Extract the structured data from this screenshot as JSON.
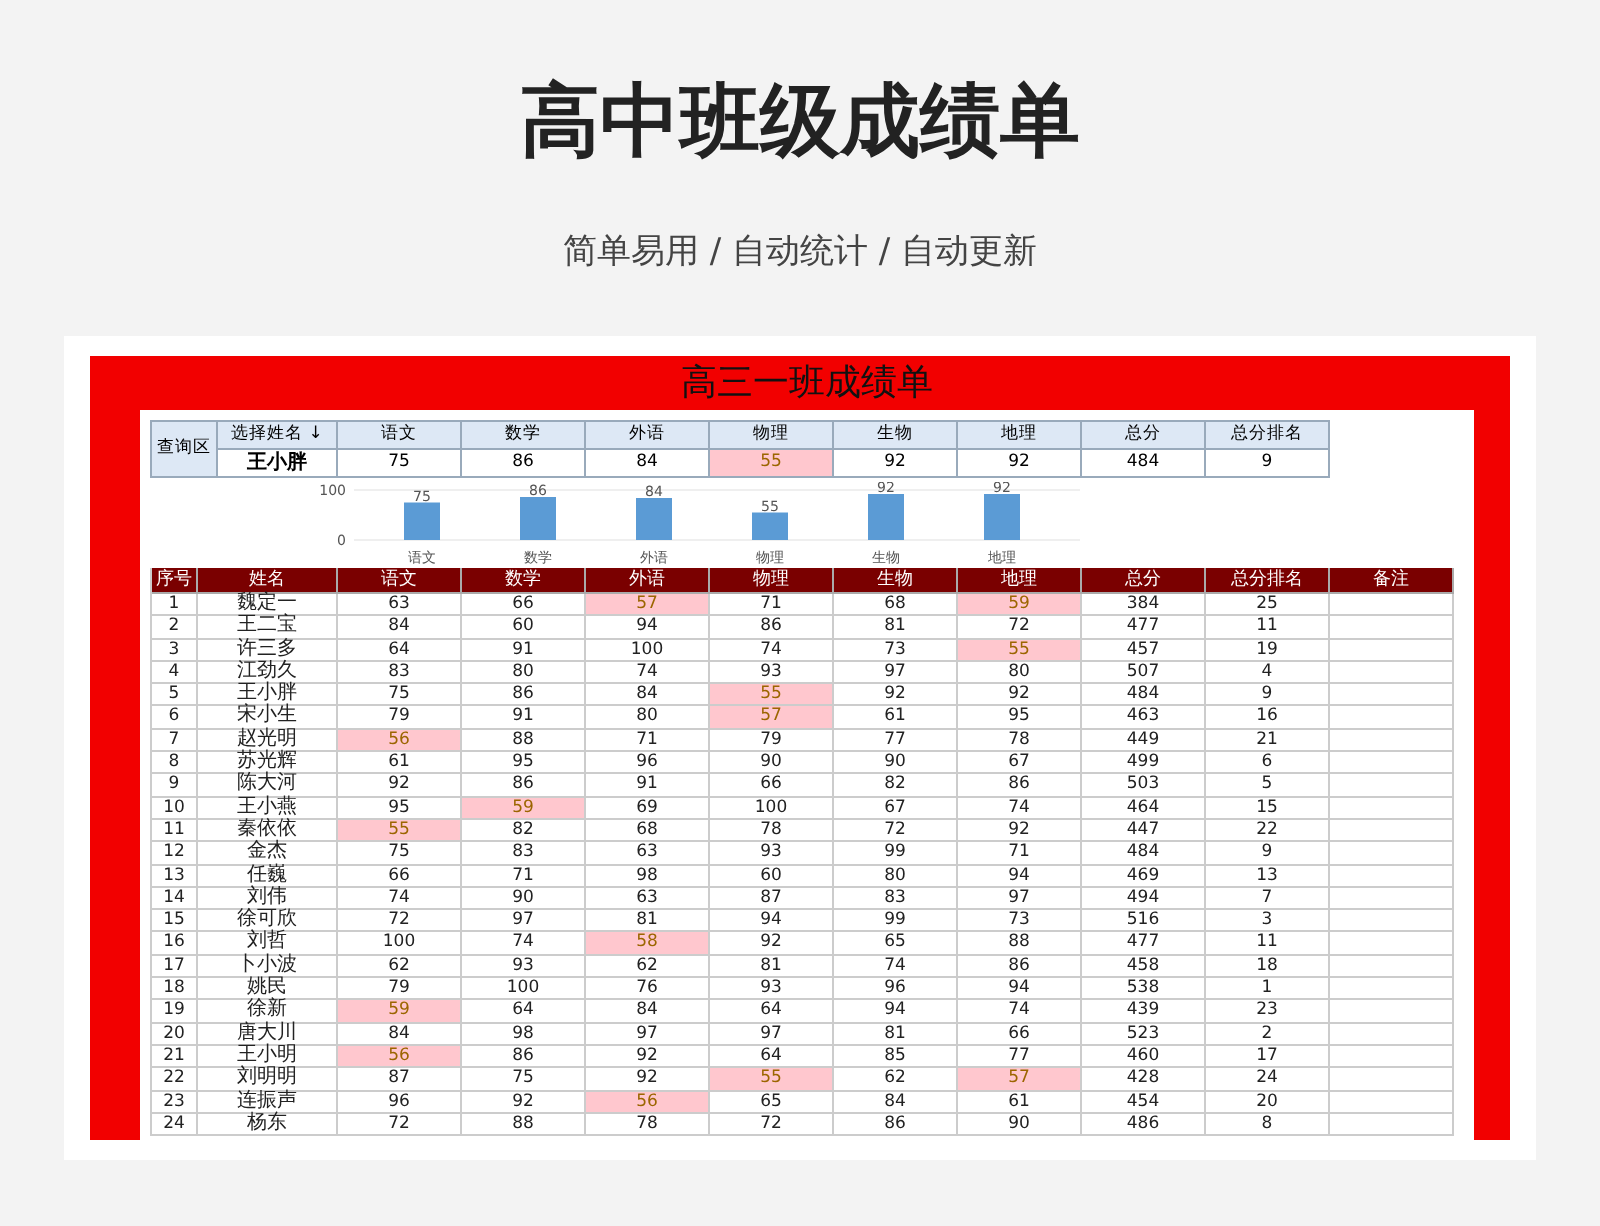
{
  "header": {
    "title": "高中班级成绩单",
    "subtitle": "简单易用 / 自动统计 / 自动更新"
  },
  "sheet": {
    "title": "高三一班成绩单",
    "query": {
      "label": "查询区",
      "select_label": "选择姓名 ↓",
      "columns": [
        "语文",
        "数学",
        "外语",
        "物理",
        "生物",
        "地理",
        "总分",
        "总分排名"
      ],
      "name": "王小胖",
      "values": [
        {
          "value": "75",
          "low": false
        },
        {
          "value": "86",
          "low": false
        },
        {
          "value": "84",
          "low": false
        },
        {
          "value": "55",
          "low": true
        },
        {
          "value": "92",
          "low": false
        },
        {
          "value": "92",
          "low": false
        },
        {
          "value": "484",
          "low": false
        },
        {
          "value": "9",
          "low": false
        }
      ]
    },
    "chart_data": {
      "type": "bar",
      "categories": [
        "语文",
        "数学",
        "外语",
        "物理",
        "生物",
        "地理"
      ],
      "values": [
        75,
        86,
        84,
        55,
        92,
        92
      ],
      "ylim": [
        0,
        100
      ],
      "yticks": [
        0,
        100
      ],
      "value_labels": [
        "75",
        "86",
        "84",
        "55",
        "92",
        "92"
      ]
    },
    "table": {
      "columns": [
        "序号",
        "姓名",
        "语文",
        "数学",
        "外语",
        "物理",
        "生物",
        "地理",
        "总分",
        "总分排名",
        "备注"
      ],
      "rows": [
        {
          "no": "1",
          "name": "魏定一",
          "scores": [
            {
              "value": "63",
              "low": false
            },
            {
              "value": "66",
              "low": false
            },
            {
              "value": "57",
              "low": true
            },
            {
              "value": "71",
              "low": false
            },
            {
              "value": "68",
              "low": false
            },
            {
              "value": "59",
              "low": true
            }
          ],
          "total": "384",
          "rank": "25"
        },
        {
          "no": "2",
          "name": "王二宝",
          "scores": [
            {
              "value": "84",
              "low": false
            },
            {
              "value": "60",
              "low": false
            },
            {
              "value": "94",
              "low": false
            },
            {
              "value": "86",
              "low": false
            },
            {
              "value": "81",
              "low": false
            },
            {
              "value": "72",
              "low": false
            }
          ],
          "total": "477",
          "rank": "11"
        },
        {
          "no": "3",
          "name": "许三多",
          "scores": [
            {
              "value": "64",
              "low": false
            },
            {
              "value": "91",
              "low": false
            },
            {
              "value": "100",
              "low": false
            },
            {
              "value": "74",
              "low": false
            },
            {
              "value": "73",
              "low": false
            },
            {
              "value": "55",
              "low": true
            }
          ],
          "total": "457",
          "rank": "19"
        },
        {
          "no": "4",
          "name": "江劲久",
          "scores": [
            {
              "value": "83",
              "low": false
            },
            {
              "value": "80",
              "low": false
            },
            {
              "value": "74",
              "low": false
            },
            {
              "value": "93",
              "low": false
            },
            {
              "value": "97",
              "low": false
            },
            {
              "value": "80",
              "low": false
            }
          ],
          "total": "507",
          "rank": "4"
        },
        {
          "no": "5",
          "name": "王小胖",
          "scores": [
            {
              "value": "75",
              "low": false
            },
            {
              "value": "86",
              "low": false
            },
            {
              "value": "84",
              "low": false
            },
            {
              "value": "55",
              "low": true
            },
            {
              "value": "92",
              "low": false
            },
            {
              "value": "92",
              "low": false
            }
          ],
          "total": "484",
          "rank": "9"
        },
        {
          "no": "6",
          "name": "宋小生",
          "scores": [
            {
              "value": "79",
              "low": false
            },
            {
              "value": "91",
              "low": false
            },
            {
              "value": "80",
              "low": false
            },
            {
              "value": "57",
              "low": true
            },
            {
              "value": "61",
              "low": false
            },
            {
              "value": "95",
              "low": false
            }
          ],
          "total": "463",
          "rank": "16"
        },
        {
          "no": "7",
          "name": "赵光明",
          "scores": [
            {
              "value": "56",
              "low": true
            },
            {
              "value": "88",
              "low": false
            },
            {
              "value": "71",
              "low": false
            },
            {
              "value": "79",
              "low": false
            },
            {
              "value": "77",
              "low": false
            },
            {
              "value": "78",
              "low": false
            }
          ],
          "total": "449",
          "rank": "21"
        },
        {
          "no": "8",
          "name": "苏光辉",
          "scores": [
            {
              "value": "61",
              "low": false
            },
            {
              "value": "95",
              "low": false
            },
            {
              "value": "96",
              "low": false
            },
            {
              "value": "90",
              "low": false
            },
            {
              "value": "90",
              "low": false
            },
            {
              "value": "67",
              "low": false
            }
          ],
          "total": "499",
          "rank": "6"
        },
        {
          "no": "9",
          "name": "陈大河",
          "scores": [
            {
              "value": "92",
              "low": false
            },
            {
              "value": "86",
              "low": false
            },
            {
              "value": "91",
              "low": false
            },
            {
              "value": "66",
              "low": false
            },
            {
              "value": "82",
              "low": false
            },
            {
              "value": "86",
              "low": false
            }
          ],
          "total": "503",
          "rank": "5"
        },
        {
          "no": "10",
          "name": "王小燕",
          "scores": [
            {
              "value": "95",
              "low": false
            },
            {
              "value": "59",
              "low": true
            },
            {
              "value": "69",
              "low": false
            },
            {
              "value": "100",
              "low": false
            },
            {
              "value": "67",
              "low": false
            },
            {
              "value": "74",
              "low": false
            }
          ],
          "total": "464",
          "rank": "15"
        },
        {
          "no": "11",
          "name": "秦依依",
          "scores": [
            {
              "value": "55",
              "low": true
            },
            {
              "value": "82",
              "low": false
            },
            {
              "value": "68",
              "low": false
            },
            {
              "value": "78",
              "low": false
            },
            {
              "value": "72",
              "low": false
            },
            {
              "value": "92",
              "low": false
            }
          ],
          "total": "447",
          "rank": "22"
        },
        {
          "no": "12",
          "name": "金杰",
          "scores": [
            {
              "value": "75",
              "low": false
            },
            {
              "value": "83",
              "low": false
            },
            {
              "value": "63",
              "low": false
            },
            {
              "value": "93",
              "low": false
            },
            {
              "value": "99",
              "low": false
            },
            {
              "value": "71",
              "low": false
            }
          ],
          "total": "484",
          "rank": "9"
        },
        {
          "no": "13",
          "name": "任巍",
          "scores": [
            {
              "value": "66",
              "low": false
            },
            {
              "value": "71",
              "low": false
            },
            {
              "value": "98",
              "low": false
            },
            {
              "value": "60",
              "low": false
            },
            {
              "value": "80",
              "low": false
            },
            {
              "value": "94",
              "low": false
            }
          ],
          "total": "469",
          "rank": "13"
        },
        {
          "no": "14",
          "name": "刘伟",
          "scores": [
            {
              "value": "74",
              "low": false
            },
            {
              "value": "90",
              "low": false
            },
            {
              "value": "63",
              "low": false
            },
            {
              "value": "87",
              "low": false
            },
            {
              "value": "83",
              "low": false
            },
            {
              "value": "97",
              "low": false
            }
          ],
          "total": "494",
          "rank": "7"
        },
        {
          "no": "15",
          "name": "徐可欣",
          "scores": [
            {
              "value": "72",
              "low": false
            },
            {
              "value": "97",
              "low": false
            },
            {
              "value": "81",
              "low": false
            },
            {
              "value": "94",
              "low": false
            },
            {
              "value": "99",
              "low": false
            },
            {
              "value": "73",
              "low": false
            }
          ],
          "total": "516",
          "rank": "3"
        },
        {
          "no": "16",
          "name": "刘哲",
          "scores": [
            {
              "value": "100",
              "low": false
            },
            {
              "value": "74",
              "low": false
            },
            {
              "value": "58",
              "low": true
            },
            {
              "value": "92",
              "low": false
            },
            {
              "value": "65",
              "low": false
            },
            {
              "value": "88",
              "low": false
            }
          ],
          "total": "477",
          "rank": "11"
        },
        {
          "no": "17",
          "name": "卜小波",
          "scores": [
            {
              "value": "62",
              "low": false
            },
            {
              "value": "93",
              "low": false
            },
            {
              "value": "62",
              "low": false
            },
            {
              "value": "81",
              "low": false
            },
            {
              "value": "74",
              "low": false
            },
            {
              "value": "86",
              "low": false
            }
          ],
          "total": "458",
          "rank": "18"
        },
        {
          "no": "18",
          "name": "姚民",
          "scores": [
            {
              "value": "79",
              "low": false
            },
            {
              "value": "100",
              "low": false
            },
            {
              "value": "76",
              "low": false
            },
            {
              "value": "93",
              "low": false
            },
            {
              "value": "96",
              "low": false
            },
            {
              "value": "94",
              "low": false
            }
          ],
          "total": "538",
          "rank": "1"
        },
        {
          "no": "19",
          "name": "徐新",
          "scores": [
            {
              "value": "59",
              "low": true
            },
            {
              "value": "64",
              "low": false
            },
            {
              "value": "84",
              "low": false
            },
            {
              "value": "64",
              "low": false
            },
            {
              "value": "94",
              "low": false
            },
            {
              "value": "74",
              "low": false
            }
          ],
          "total": "439",
          "rank": "23"
        },
        {
          "no": "20",
          "name": "唐大川",
          "scores": [
            {
              "value": "84",
              "low": false
            },
            {
              "value": "98",
              "low": false
            },
            {
              "value": "97",
              "low": false
            },
            {
              "value": "97",
              "low": false
            },
            {
              "value": "81",
              "low": false
            },
            {
              "value": "66",
              "low": false
            }
          ],
          "total": "523",
          "rank": "2"
        },
        {
          "no": "21",
          "name": "王小明",
          "scores": [
            {
              "value": "56",
              "low": true
            },
            {
              "value": "86",
              "low": false
            },
            {
              "value": "92",
              "low": false
            },
            {
              "value": "64",
              "low": false
            },
            {
              "value": "85",
              "low": false
            },
            {
              "value": "77",
              "low": false
            }
          ],
          "total": "460",
          "rank": "17"
        },
        {
          "no": "22",
          "name": "刘明明",
          "scores": [
            {
              "value": "87",
              "low": false
            },
            {
              "value": "75",
              "low": false
            },
            {
              "value": "92",
              "low": false
            },
            {
              "value": "55",
              "low": true
            },
            {
              "value": "62",
              "low": false
            },
            {
              "value": "57",
              "low": true
            }
          ],
          "total": "428",
          "rank": "24"
        },
        {
          "no": "23",
          "name": "连振声",
          "scores": [
            {
              "value": "96",
              "low": false
            },
            {
              "value": "92",
              "low": false
            },
            {
              "value": "56",
              "low": true
            },
            {
              "value": "65",
              "low": false
            },
            {
              "value": "84",
              "low": false
            },
            {
              "value": "61",
              "low": false
            }
          ],
          "total": "454",
          "rank": "20"
        },
        {
          "no": "24",
          "name": "杨东",
          "scores": [
            {
              "value": "72",
              "low": false
            },
            {
              "value": "88",
              "low": false
            },
            {
              "value": "78",
              "low": false
            },
            {
              "value": "72",
              "low": false
            },
            {
              "value": "86",
              "low": false
            },
            {
              "value": "90",
              "low": false
            }
          ],
          "total": "486",
          "rank": "8"
        }
      ]
    }
  }
}
